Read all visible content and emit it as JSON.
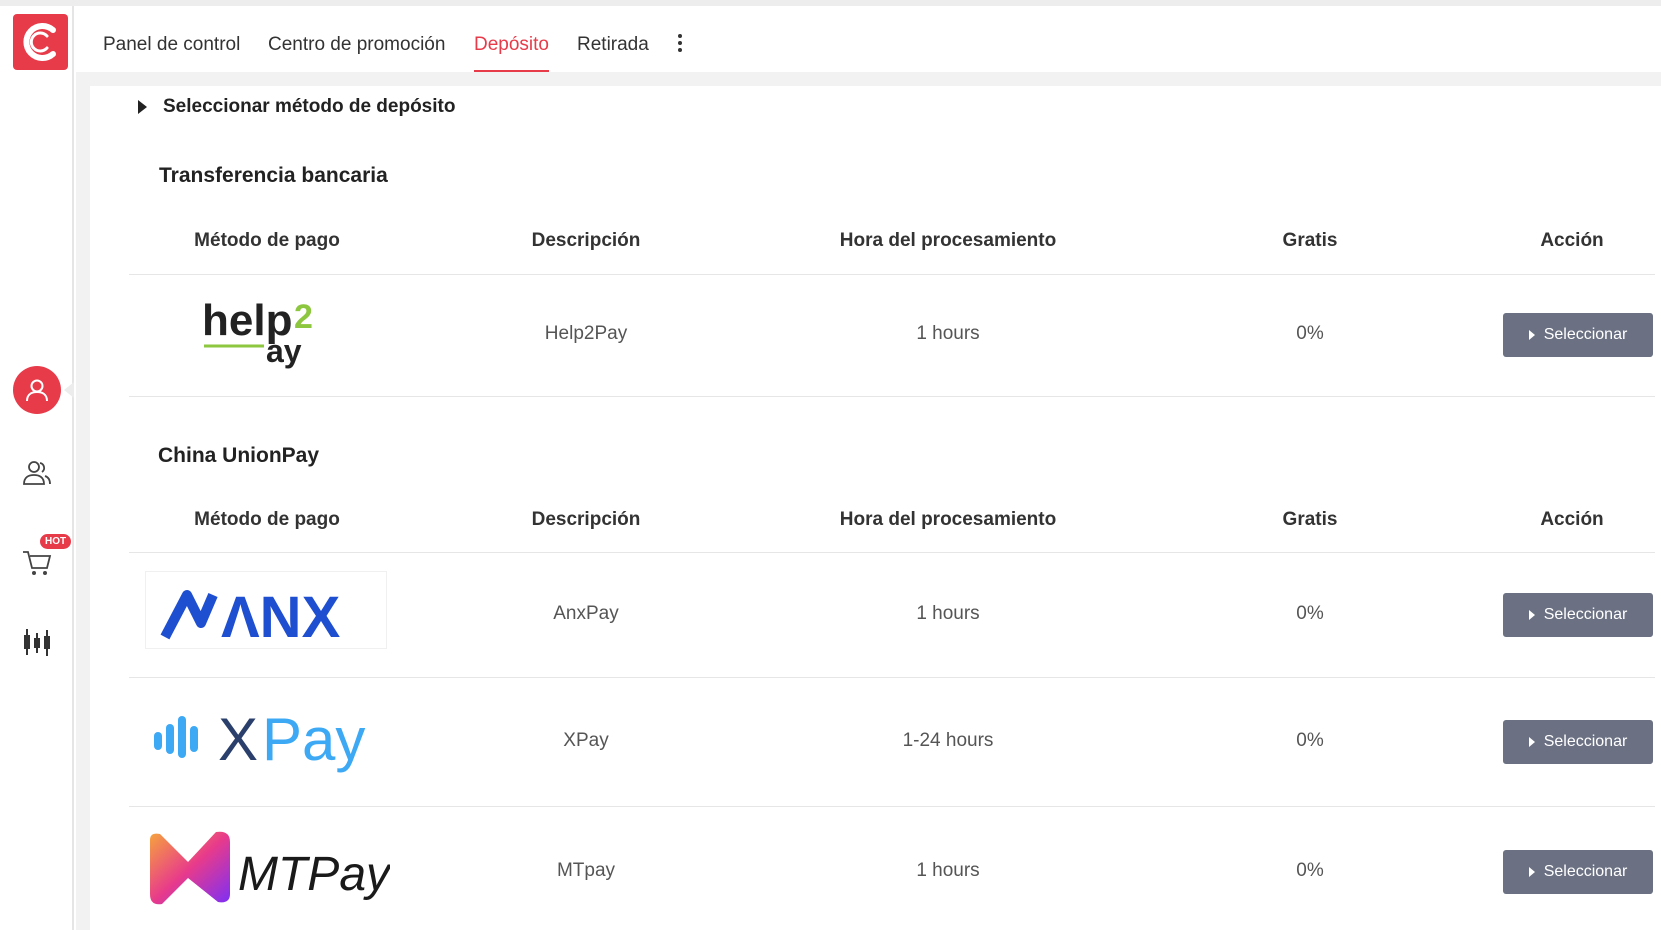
{
  "nav": {
    "tabs": [
      {
        "label": "Panel de control"
      },
      {
        "label": "Centro de promoción"
      },
      {
        "label": "Depósito"
      },
      {
        "label": "Retirada"
      }
    ]
  },
  "sidebar": {
    "hot_badge": "HOT",
    "icons": [
      "user-icon",
      "users-icon",
      "cart-icon",
      "candlestick-chart-icon"
    ]
  },
  "section": {
    "title": "Seleccionar método de depósito"
  },
  "columns": {
    "method": "Método de pago",
    "description": "Descripción",
    "processing": "Hora del procesamiento",
    "fee": "Gratis",
    "action": "Acción"
  },
  "groups": [
    {
      "title": "Transferencia bancaria",
      "rows": [
        {
          "logo_text": "help2pay",
          "description": "Help2Pay",
          "time": "1 hours",
          "fee": "0%",
          "button": "Seleccionar"
        }
      ]
    },
    {
      "title": "China UnionPay",
      "rows": [
        {
          "logo_text": "ANX",
          "description": "AnxPay",
          "time": "1 hours",
          "fee": "0%",
          "button": "Seleccionar"
        },
        {
          "logo_text": "XPay",
          "description": "XPay",
          "time": "1-24 hours",
          "fee": "0%",
          "button": "Seleccionar"
        },
        {
          "logo_text": "MTPay",
          "description": "MTpay",
          "time": "1 hours",
          "fee": "0%",
          "button": "Seleccionar"
        }
      ]
    }
  ],
  "colors": {
    "accent": "#e83b4a",
    "button": "#6b7183"
  }
}
